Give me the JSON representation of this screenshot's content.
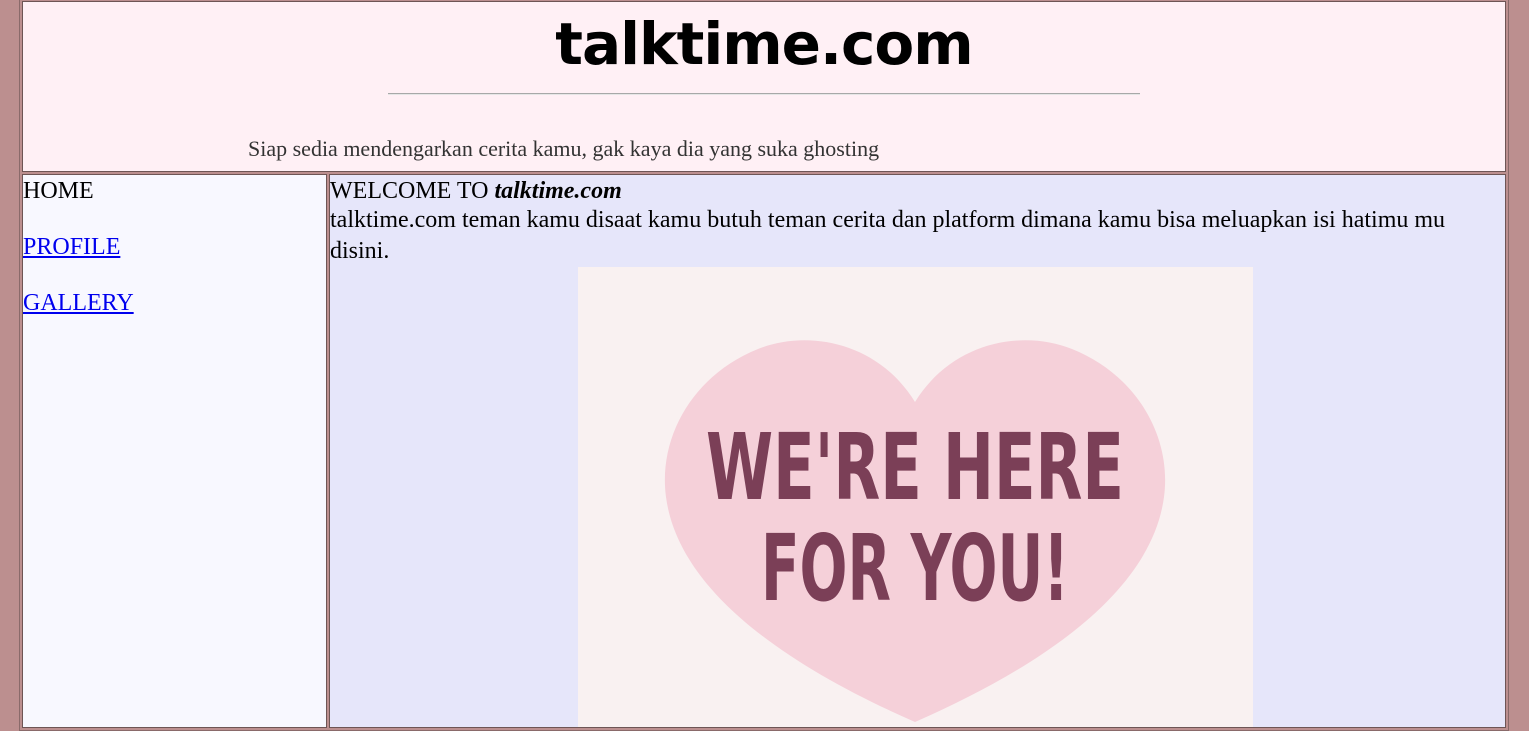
{
  "header": {
    "site_title": "talktime.com",
    "tagline": "Siap sedia mendengarkan cerita kamu, gak kaya dia yang suka ghosting"
  },
  "sidebar": {
    "items": [
      {
        "label": "HOME",
        "link": false
      },
      {
        "label": "PROFILE",
        "link": true
      },
      {
        "label": "GALLERY",
        "link": true
      }
    ]
  },
  "main": {
    "welcome_prefix": "WELCOME TO",
    "welcome_brand": "talktime.com",
    "description": "talktime.com teman kamu disaat kamu butuh teman cerita dan platform dimana kamu bisa meluapkan isi hatimu mu disini.",
    "banner": {
      "line1": "WE'RE HERE",
      "line2": "FOR YOU!",
      "heart_color": "#f5d0d9",
      "text_color": "#7b3f57",
      "bg_color": "#f9f1f1"
    }
  },
  "colors": {
    "page_bg": "#bc8f8f",
    "header_bg": "#fff0f5",
    "sidebar_bg": "#f8f8ff",
    "content_bg": "#e6e6fa",
    "link": "#0000ee"
  }
}
